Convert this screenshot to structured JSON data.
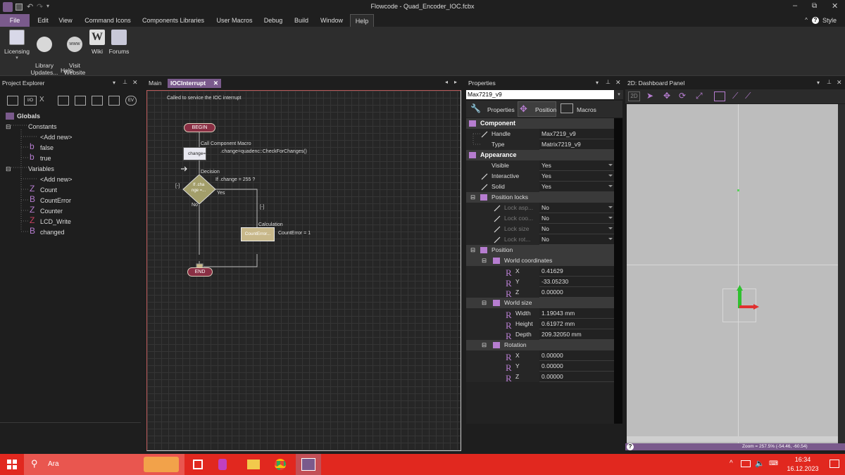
{
  "window": {
    "title": "Flowcode - Quad_Encoder_IOC.fcbx"
  },
  "menu": {
    "items": [
      "File",
      "Edit",
      "View",
      "Command Icons",
      "Components Libraries",
      "User Macros",
      "Debug",
      "Build",
      "Window",
      "Help"
    ],
    "style": "Style"
  },
  "ribbon": {
    "buttons": [
      {
        "label": "Licensing",
        "icon": "licensing-icon"
      },
      {
        "label": "Library\nUpdates...",
        "icon": "library-updates-icon"
      },
      {
        "label": "Visit\nWebsite",
        "icon": "www-icon"
      },
      {
        "label": "Wiki",
        "icon": "wiki-icon"
      },
      {
        "label": "Forums",
        "icon": "forums-icon"
      }
    ],
    "group_label": "Help"
  },
  "project_explorer": {
    "title": "Project Explorer",
    "toolbar_icons": [
      "globals-tool-icon",
      "io-tool-icon",
      "x-tool-icon",
      "chip-tool-icon",
      "port-tool-icon",
      "component-tool-icon",
      "panel-tool-icon",
      "ev-tool-icon"
    ],
    "tree": {
      "globals": "Globals",
      "constants": "Constants",
      "constants_items": [
        {
          "prefix": "",
          "label": "<Add new>"
        },
        {
          "prefix": "b",
          "label": "false"
        },
        {
          "prefix": "b",
          "label": "true"
        }
      ],
      "variables": "Variables",
      "variables_items": [
        {
          "prefix": "",
          "label": "<Add new>"
        },
        {
          "prefix": "Z",
          "label": "Count"
        },
        {
          "prefix": "B",
          "label": "CountError"
        },
        {
          "prefix": "Z",
          "label": "Counter"
        },
        {
          "prefix": "Z",
          "label": "LCD_Write"
        },
        {
          "prefix": "B",
          "label": "changed"
        }
      ]
    }
  },
  "editor": {
    "tabs": [
      {
        "label": "Main",
        "active": false
      },
      {
        "label": "IOCInterrupt",
        "active": true
      }
    ],
    "comment": "Called to service the IOC interrupt",
    "begin": "BEGIN",
    "end": "END",
    "call_title": "Call Component Macro",
    "call_box": "change=",
    "call_text": ".change=quadenc::CheckForChanges()",
    "decision_title": "Decision",
    "decision_text": "If .change = 255 ?",
    "decision_box_1": "If .cha",
    "decision_box_2": "nge =...",
    "yes": "Yes",
    "no": "No",
    "collapse_left": "[-]",
    "collapse_right": "[-]",
    "calc_title": "Calculation",
    "calc_box": "CountError...",
    "calc_text": "CountError = 1"
  },
  "properties": {
    "title": "Properties",
    "selected": "Max7219_v9",
    "tabs": [
      "Properties",
      "Position",
      "Macros"
    ],
    "component_section": "Component",
    "handle_key": "Handle",
    "handle_val": "Max7219_v9",
    "type_key": "Type",
    "type_val": "Matrix7219_v9",
    "appearance_section": "Appearance",
    "visible_key": "Visible",
    "visible_val": "Yes",
    "interactive_key": "Interactive",
    "interactive_val": "Yes",
    "solid_key": "Solid",
    "solid_val": "Yes",
    "poslocks_section": "Position locks",
    "lock1_key": "Lock asp...",
    "lock1_val": "No",
    "lock2_key": "Lock coo...",
    "lock2_val": "No",
    "lock3_key": "Lock size",
    "lock3_val": "No",
    "lock4_key": "Lock rot...",
    "lock4_val": "No",
    "position_section": "Position",
    "world_coords": "World coordinates",
    "x_key": "X",
    "x_val": "0.41629",
    "y_key": "Y",
    "y_val": "-33.05230",
    "z_key": "Z",
    "z_val": "0.00000",
    "world_size": "World size",
    "width_key": "Width",
    "width_val": "1.19043 mm",
    "height_key": "Height",
    "height_val": "0.61972 mm",
    "depth_key": "Depth",
    "depth_val": "209.32050 mm",
    "rotation": "Rotation",
    "rx_key": "X",
    "rx_val": "0.00000",
    "ry_key": "Y",
    "ry_val": "0.00000",
    "rz_key": "Z",
    "rz_val": "0.00000"
  },
  "dashboard": {
    "title": "2D: Dashboard Panel",
    "mode": "2D",
    "status": "Zoom = 257.5% (-54.46, -60.54)"
  },
  "taskbar": {
    "search_placeholder": "Ara",
    "time": "16:34",
    "date": "16.12.2023"
  },
  "colors": {
    "accent": "#7a5a8c",
    "taskbar": "#e1281f",
    "panel": "#2d2d2d"
  }
}
